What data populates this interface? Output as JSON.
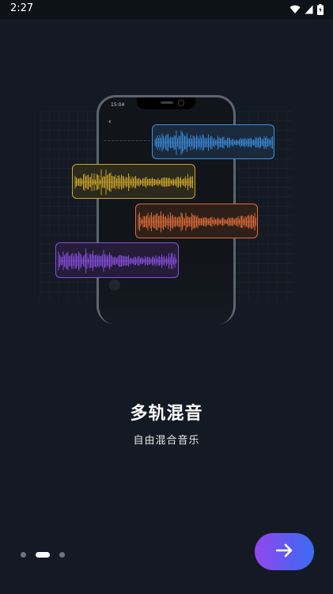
{
  "status_bar": {
    "time": "2:27",
    "icons": [
      "wifi-icon",
      "signal-icon",
      "battery-charging-icon"
    ]
  },
  "illustration": {
    "phone_time": "15:04",
    "tracks": [
      {
        "name": "blue-track",
        "color": "#3b8fe0"
      },
      {
        "name": "yellow-track",
        "color": "#c9a427"
      },
      {
        "name": "orange-track",
        "color": "#e06a35"
      },
      {
        "name": "purple-track",
        "color": "#8a4ee0"
      }
    ]
  },
  "onboarding": {
    "title": "多轨混音",
    "subtitle": "自由混合音乐"
  },
  "pager": {
    "total": 3,
    "active_index": 1
  },
  "next_button": {
    "icon": "arrow-right-icon"
  },
  "colors": {
    "background": "#141a23",
    "accent_start": "#9446ef",
    "accent_end": "#3d6cf2"
  }
}
